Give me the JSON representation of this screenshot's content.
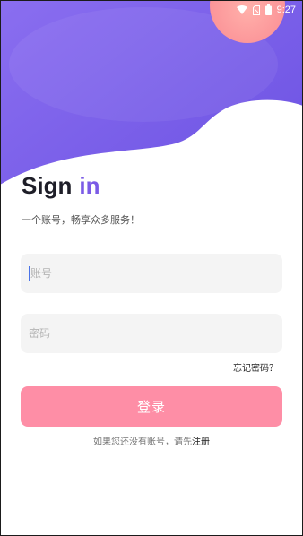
{
  "status_bar": {
    "time": "9:27",
    "icons": [
      "wifi-icon",
      "sim-icon",
      "battery-icon"
    ]
  },
  "header": {
    "title_main": "Sign",
    "title_accent": "in",
    "subtitle": "一个账号，畅享众多服务！"
  },
  "form": {
    "account_placeholder": "账号",
    "password_placeholder": "密码",
    "forgot_label": "忘记密码？",
    "login_label": "登录"
  },
  "footer": {
    "register_prompt": "如果您还没有账号，请先",
    "register_link": "注册"
  },
  "colors": {
    "accent_purple": "#7b5be6",
    "login_pink": "#fe8ea6",
    "circle_pink": "#fd9c9c",
    "field_bg": "#f4f4f4"
  }
}
